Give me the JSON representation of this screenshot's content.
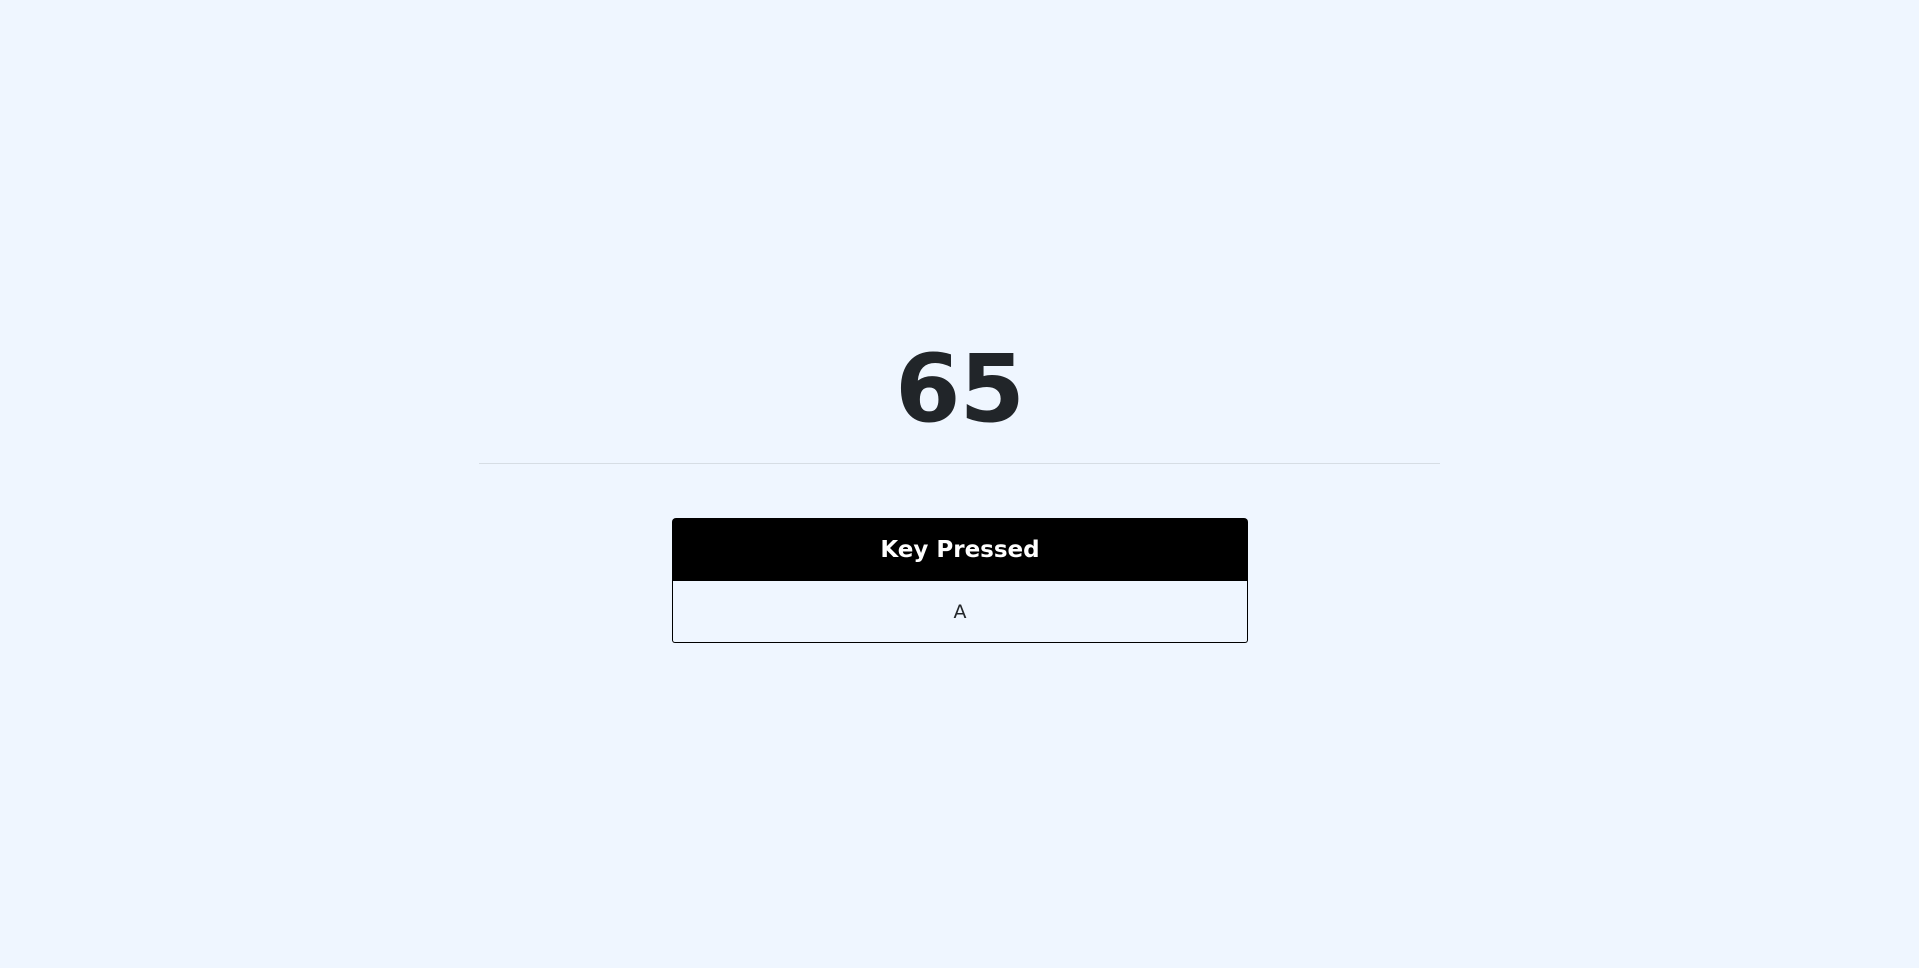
{
  "key_code": "65",
  "table": {
    "header": "Key Pressed",
    "value": "A"
  },
  "colors": {
    "background": "#eff6ff",
    "header_bg": "#000000",
    "header_text": "#ffffff",
    "text": "#212529"
  }
}
